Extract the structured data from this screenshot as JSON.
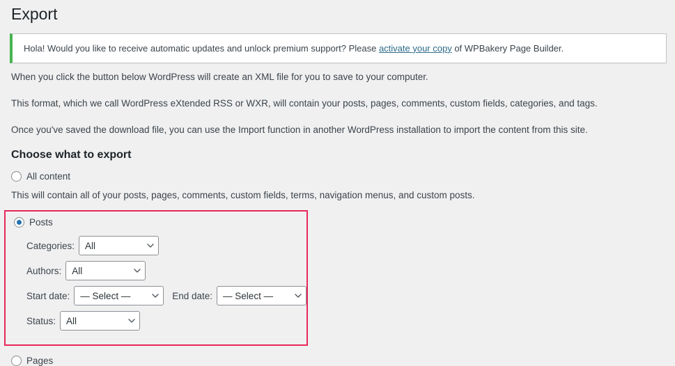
{
  "page": {
    "title": "Export"
  },
  "notice": {
    "text_before": "Hola! Would you like to receive automatic updates and unlock premium support? Please ",
    "link_text": "activate your copy",
    "text_after": " of WPBakery Page Builder.",
    "accent_color": "#46b450"
  },
  "intro": {
    "paragraph1": "When you click the button below WordPress will create an XML file for you to save to your computer.",
    "paragraph2": "This format, which we call WordPress eXtended RSS or WXR, will contain your posts, pages, comments, custom fields, categories, and tags.",
    "paragraph3": "Once you've saved the download file, you can use the Import function in another WordPress installation to import the content from this site."
  },
  "choose": {
    "heading": "Choose what to export",
    "all_content": {
      "label": "All content",
      "selected": false,
      "description": "This will contain all of your posts, pages, comments, custom fields, terms, navigation menus, and custom posts."
    },
    "posts": {
      "label": "Posts",
      "selected": true,
      "highlight_color": "#e8275a",
      "fields": {
        "categories_label": "Categories:",
        "categories_value": "All",
        "authors_label": "Authors:",
        "authors_value": "All",
        "start_date_label": "Start date:",
        "start_date_value": "— Select —",
        "end_date_label": "End date:",
        "end_date_value": "— Select —",
        "status_label": "Status:",
        "status_value": "All"
      }
    },
    "pages": {
      "label": "Pages",
      "selected": false
    }
  }
}
